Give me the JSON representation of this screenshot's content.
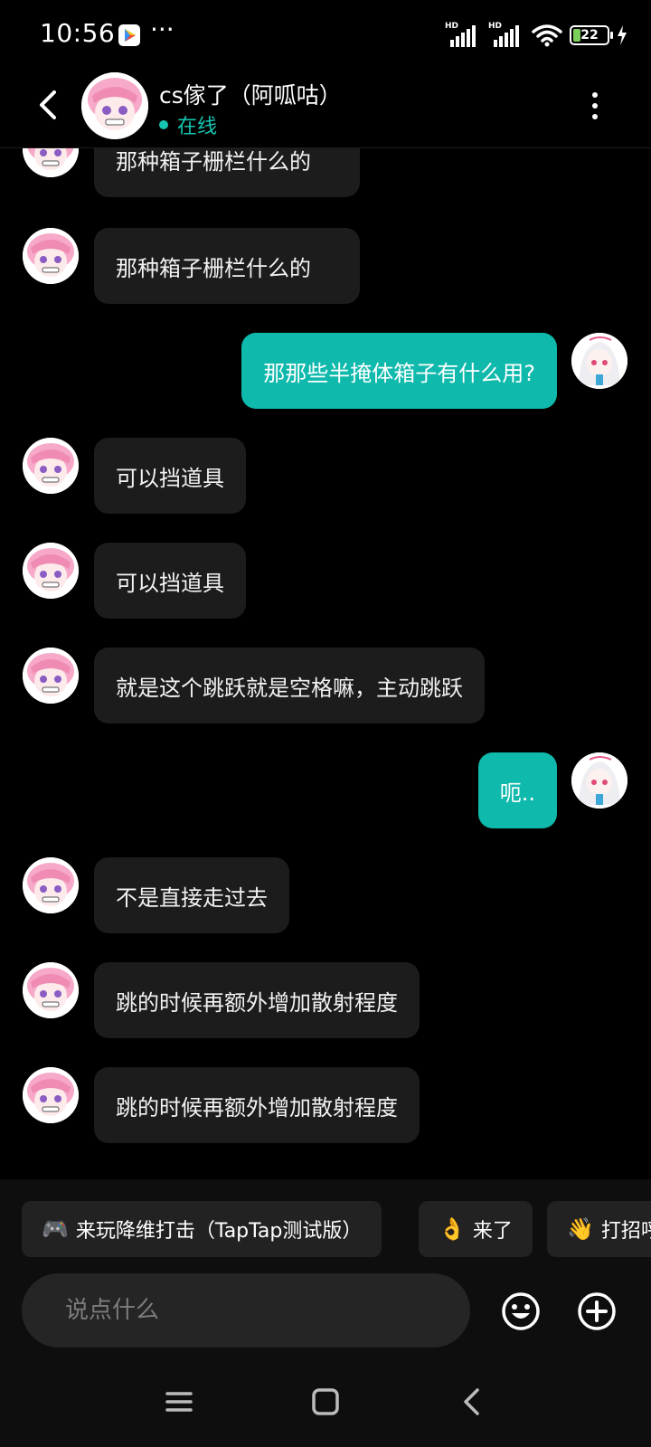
{
  "status_bar": {
    "time": "10:56",
    "dots": "···",
    "network_1": "HD",
    "network_2": "HD",
    "battery_level": "22"
  },
  "header": {
    "contact_name": "cs傢了（阿呱咕）",
    "status_text": "在线",
    "status_color": "#15c5b1"
  },
  "messages": [
    {
      "side": "in",
      "text": "那种箱子栅栏什么的"
    },
    {
      "side": "in",
      "text": "那种箱子栅栏什么的"
    },
    {
      "side": "out",
      "text": "那那些半掩体箱子有什么用?"
    },
    {
      "side": "in",
      "text": "可以挡道具"
    },
    {
      "side": "in",
      "text": "可以挡道具"
    },
    {
      "side": "in",
      "text": "就是这个跳跃就是空格嘛，主动跳跃"
    },
    {
      "side": "out",
      "text": "呃.."
    },
    {
      "side": "in",
      "text": "不是直接走过去"
    },
    {
      "side": "in",
      "text": "跳的时候再额外增加散射程度"
    },
    {
      "side": "in",
      "text": "跳的时候再额外增加散射程度"
    }
  ],
  "quick_replies": [
    {
      "icon": "game-controller-icon",
      "emoji": "🎮",
      "label": "来玩降维打击（TapTap测试版）"
    },
    {
      "icon": "ok-hand-icon",
      "emoji": "👌",
      "label": "来了"
    },
    {
      "icon": "waving-hand-icon",
      "emoji": "👋",
      "label": "打招呼"
    }
  ],
  "composer": {
    "placeholder": "说点什么"
  },
  "colors": {
    "accent": "#0fb9ac",
    "incoming_bubble": "#1c1c1c",
    "background": "#000000"
  }
}
